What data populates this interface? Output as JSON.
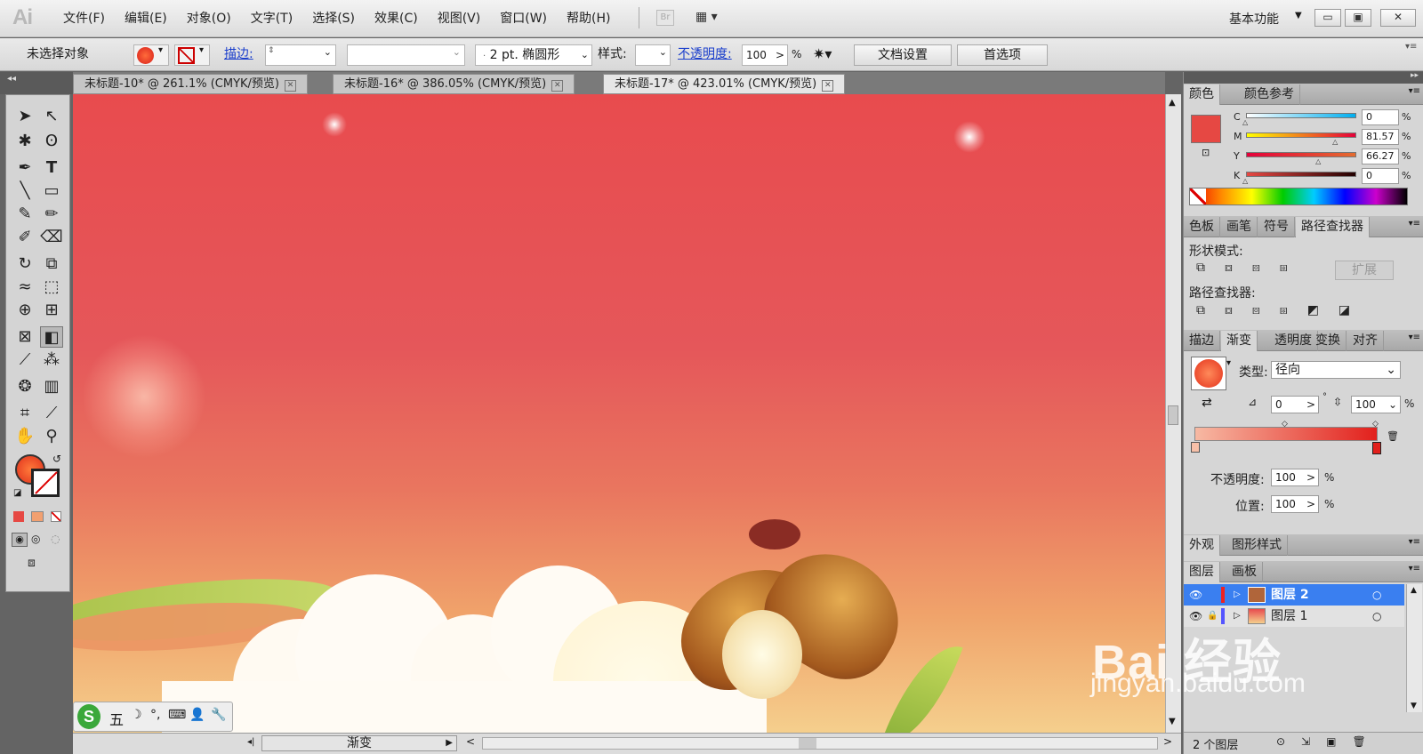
{
  "app": {
    "logo": "Ai",
    "br_label": "Br",
    "workspace": "基本功能"
  },
  "menu": [
    "文件(F)",
    "编辑(E)",
    "对象(O)",
    "文字(T)",
    "选择(S)",
    "效果(C)",
    "视图(V)",
    "窗口(W)",
    "帮助(H)"
  ],
  "control": {
    "selection": "未选择对象",
    "stroke_label": "描边:",
    "brush_value": "2 pt. 椭圆形",
    "style_label": "样式:",
    "opacity_label": "不透明度:",
    "opacity_value": "100",
    "opacity_unit": "%",
    "doc_setup": "文档设置",
    "preferences": "首选项"
  },
  "tabs": [
    {
      "label": "未标题-10* @ 261.1% (CMYK/预览)"
    },
    {
      "label": "未标题-16* @ 386.05% (CMYK/预览)"
    },
    {
      "label": "未标题-17* @ 423.01% (CMYK/预览)"
    }
  ],
  "color_panel": {
    "tabs": [
      "颜色",
      "颜色参考"
    ],
    "channels": [
      {
        "name": "C",
        "value": "0",
        "level": 0
      },
      {
        "name": "M",
        "value": "81.57",
        "level": 0.8157
      },
      {
        "name": "Y",
        "value": "66.27",
        "level": 0.6627
      },
      {
        "name": "K",
        "value": "0",
        "level": 0
      }
    ],
    "unit": "%",
    "fill_color": "#e64843"
  },
  "pathfinder": {
    "tabs": [
      "色板",
      "画笔",
      "符号",
      "路径查找器"
    ],
    "shape_modes": "形状模式:",
    "expand": "扩展",
    "pathfinders": "路径查找器:"
  },
  "gradient": {
    "tabs": [
      "描边",
      "渐变",
      "透明度",
      "变换",
      "对齐"
    ],
    "type_label": "类型:",
    "type_value": "径向",
    "angle": "0",
    "aspect": "100",
    "opacity_label": "不透明度:",
    "opacity_value": "100",
    "position_label": "位置:",
    "position_value": "100",
    "unit": "%"
  },
  "appearance": {
    "tabs": [
      "外观",
      "图形样式"
    ]
  },
  "layers": {
    "tabs": [
      "图层",
      "画板"
    ],
    "items": [
      {
        "name": "图层 2"
      },
      {
        "name": "图层 1"
      }
    ],
    "count": "2 个图层"
  },
  "status": {
    "label": "渐变"
  },
  "ime": {
    "items": [
      "五",
      "☽",
      "°,",
      "⌨",
      "👤",
      "🔧"
    ]
  },
  "watermark": {
    "brand": "Bai 经验",
    "url": "jingyan.baidu.com"
  }
}
